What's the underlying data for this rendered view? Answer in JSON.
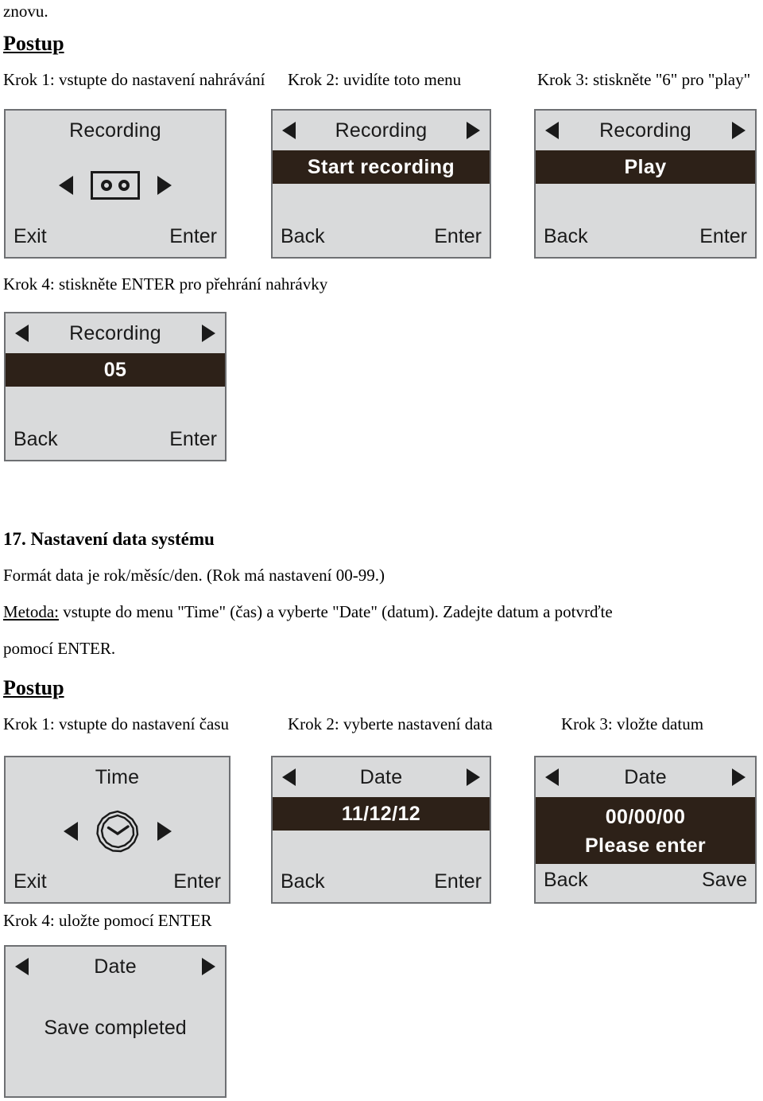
{
  "page": {
    "continuation_line": "znovu.",
    "procedure_heading_1": "Postup",
    "procedure_heading_2": "Postup"
  },
  "recording_section": {
    "steps_row1": [
      "Krok 1: vstupte do nastavení nahrávání",
      "Krok 2: uvidíte toto menu",
      "Krok 3: stiskněte \"6\" pro \"play\""
    ],
    "step4_caption": "Krok 4: stiskněte ENTER pro přehrání nahrávky",
    "screens": [
      {
        "title": "Recording",
        "icon": "cassette-tape-icon",
        "left_key": "Exit",
        "right_key": "Enter"
      },
      {
        "title": "Recording",
        "highlight": "Start  recording",
        "left_key": "Back",
        "right_key": "Enter"
      },
      {
        "title": "Recording",
        "highlight": "Play",
        "left_key": "Back",
        "right_key": "Enter"
      },
      {
        "title": "Recording",
        "highlight": "05",
        "left_key": "Back",
        "right_key": "Enter"
      }
    ]
  },
  "date_section": {
    "number_title": "17. Nastavení data systému",
    "format_line": "Formát data je rok/měsíc/den. (Rok má nastavení 00-99.)",
    "method_label": "Metoda:",
    "method_text_a": " vstupte do menu \"Time\" (čas) a vyberte \"Date\" (datum). Zadejte datum a potvrďte",
    "method_text_b": "pomocí ENTER.",
    "steps_row2": [
      "Krok 1: vstupte do nastavení času",
      "Krok 2: vyberte nastavení data",
      "Krok 3: vložte datum"
    ],
    "step4_caption": "Krok 4: uložte pomocí ENTER",
    "screens": [
      {
        "title": "Time",
        "icon": "clock-icon",
        "left_key": "Exit",
        "right_key": "Enter"
      },
      {
        "title": "Date",
        "highlight": "11/12/12",
        "left_key": "Back",
        "right_key": "Enter"
      },
      {
        "title": "Date",
        "highlight_line1": "00/00/00",
        "highlight_line2": "Please  enter",
        "left_key": "Back",
        "right_key": "Save"
      },
      {
        "title": "Date",
        "message": "Save  completed"
      }
    ]
  },
  "colors": {
    "lcd_background": "#d9dadb",
    "lcd_border": "#6e7073",
    "highlight_bar": "#2d2118",
    "highlight_text": "#ffffff",
    "text": "#1a1a1a",
    "page_background": "#ffffff"
  }
}
